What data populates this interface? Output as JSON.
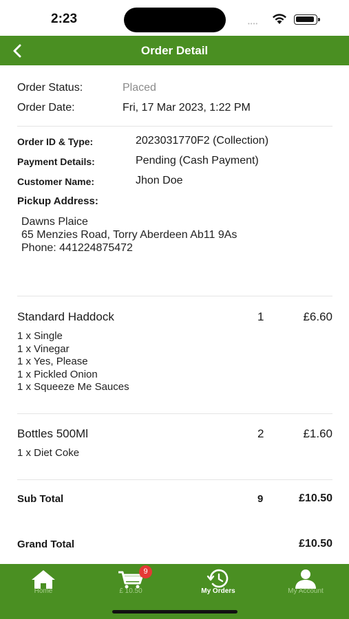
{
  "status_bar": {
    "time": "2:23",
    "signal": "••••"
  },
  "header": {
    "title": "Order Detail",
    "back_icon": "chevron-left-icon"
  },
  "order": {
    "status_label": "Order Status:",
    "status_value": "Placed",
    "date_label": "Order Date:",
    "date_value": "Fri, 17 Mar 2023, 1:22 PM",
    "id_label": "Order ID & Type:",
    "id_value": "2023031770F2 (Collection)",
    "payment_label": "Payment Details:",
    "payment_value": "Pending (Cash Payment)",
    "customer_label": "Customer Name:",
    "customer_value": "Jhon Doe",
    "pickup_label": "Pickup Address:",
    "pickup_lines": [
      "Dawns Plaice",
      "65 Menzies Road, Torry Aberdeen Ab11 9As",
      "Phone: 441224875472"
    ]
  },
  "items": [
    {
      "name": "Standard Haddock",
      "qty": "1",
      "price": "£6.60",
      "modifiers": [
        "1 x Single",
        "1 x Vinegar",
        "1 x Yes, Please",
        "1 x Pickled Onion",
        "1 x Squeeze Me Sauces"
      ]
    },
    {
      "name": "Bottles 500Ml",
      "qty": "2",
      "price": "£1.60",
      "modifiers": [
        "1 x Diet Coke"
      ]
    }
  ],
  "totals": {
    "sub_label": "Sub Total",
    "sub_qty": "9",
    "sub_value": "£10.50",
    "grand_label": "Grand Total",
    "grand_value": "£10.50"
  },
  "nav": {
    "items": [
      {
        "label": "Home",
        "icon": "home-icon"
      },
      {
        "label": "£ 10.50",
        "icon": "cart-icon",
        "badge": "9"
      },
      {
        "label": "My Orders",
        "icon": "order-history-icon",
        "active": true
      },
      {
        "label": "My Account",
        "icon": "account-icon"
      }
    ]
  },
  "colors": {
    "brand_green": "#4a8f22",
    "badge_red": "#e53935",
    "muted_text": "#8a8a8a"
  }
}
